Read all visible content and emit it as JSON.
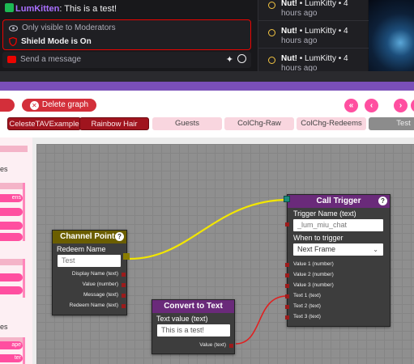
{
  "chat": {
    "user": "LumKitten",
    "message_sep": ":",
    "message": " This is a test!",
    "moderators_note": "Only visible to Moderators",
    "shield_mode": "Shield Mode is On",
    "send_placeholder": "Send a message"
  },
  "activity": [
    {
      "title": "Nut!",
      "meta": " • LumKitty • 4",
      "time": "hours ago"
    },
    {
      "title": "Nut!",
      "meta": " • LumKitty • 4",
      "time": "hours ago"
    },
    {
      "title": "Nut!",
      "meta": " • LumKitty • 4",
      "time": "hours ago"
    }
  ],
  "toolbar": {
    "delete_label": "Delete graph",
    "nav_first": "«",
    "nav_prev": "‹",
    "nav_next": "›"
  },
  "tabs": [
    {
      "label": "CelesteTAVExample"
    },
    {
      "label": "Rainbow Hair"
    },
    {
      "label": "Guests"
    },
    {
      "label": "ColChg-Raw"
    },
    {
      "label": "ColChg-Redeems"
    },
    {
      "label": "Test"
    }
  ],
  "sidebar": {
    "heading_1": "es",
    "heading_2": "es",
    "pill_1": "ens",
    "pill_2": "ape",
    "pill_3": "ter"
  },
  "nodes": {
    "channel_points": {
      "title": "Channel Points",
      "field_label": "Redeem Name",
      "field_value": "Test",
      "outputs": [
        "Display Name (text)",
        "Value (number)",
        "Message (text)",
        "Redeem Name (text)"
      ]
    },
    "convert_to_text": {
      "title": "Convert to Text",
      "field_label": "Text value (text)",
      "field_value": "This is a test!",
      "output": "Value (text)"
    },
    "call_trigger": {
      "title": "Call Trigger",
      "field_label": "Trigger Name (text)",
      "field_value": "_lum_miu_chat",
      "when_label": "When to trigger",
      "when_value": "Next Frame",
      "inputs": [
        "Value 1 (number)",
        "Value 2 (number)",
        "Value 3 (number)",
        "Text 1 (text)",
        "Text 2 (text)",
        "Text 3 (text)"
      ]
    }
  },
  "colors": {
    "wire_yellow": "#f2e600",
    "wire_red": "#e02020",
    "channel_points_header": "#6b5e00",
    "convert_header": "#6a2a7a",
    "call_trigger_header": "#6a2a7a"
  }
}
